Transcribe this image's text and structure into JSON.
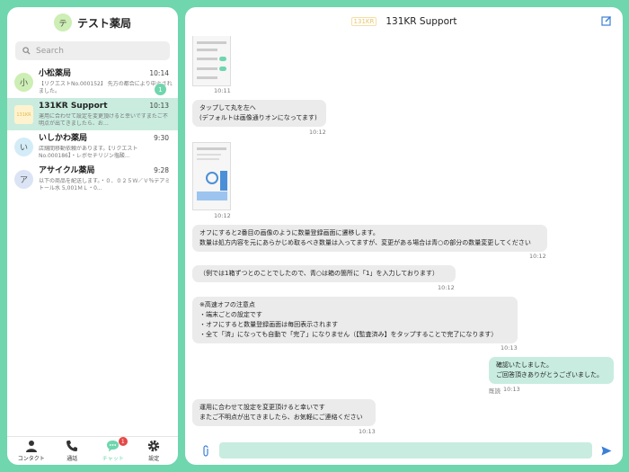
{
  "left": {
    "avatar": "テ",
    "title": "テスト薬局",
    "search_placeholder": "Search",
    "chats": [
      {
        "avatar": "小",
        "avatar_color": "#cdeeb4",
        "name": "小松薬局",
        "preview": "【リクエストNo.000152】 先方の都合により中止されました。",
        "time": "10:14",
        "badge": "1"
      },
      {
        "avatar": "131KR",
        "avatar_color": "#fff3cf",
        "name": "131KR Support",
        "preview": "運用に合わせて設定を変更頂けると幸いですまたご不明点が出てきましたら、お…",
        "time": "10:13",
        "badge": ""
      },
      {
        "avatar": "い",
        "avatar_color": "#d3ecf7",
        "name": "いしかわ薬局",
        "preview": "店舗間移動依頼があります。【リクエストNo.000186】・レボセチリジン塩酸...",
        "time": "9:30",
        "badge": ""
      },
      {
        "avatar": "ア",
        "avatar_color": "#dbe4f5",
        "name": "アサイクル薬局",
        "preview": "以下の商品を配送します。・０．０２５Ｗ／Ｖ％デアミトール水 5,001ＭＬ・0...",
        "time": "9:28",
        "badge": ""
      }
    ],
    "tabs": [
      {
        "label": "コンタクト",
        "icon": "person-icon"
      },
      {
        "label": "通話",
        "icon": "phone-icon"
      },
      {
        "label": "チャット",
        "icon": "chat-icon",
        "badge": "1"
      },
      {
        "label": "設定",
        "icon": "gear-icon"
      }
    ]
  },
  "right": {
    "logo": "131KR",
    "title": "131KR Support",
    "messages": [
      {
        "text": "",
        "time": "10:11"
      },
      {
        "text": "タップして丸を左へ\n(デフォルトは画像通りオンになってます)",
        "time": "10:12"
      },
      {
        "text": "",
        "time": "10:12"
      },
      {
        "text": "オフにすると2番目の画像のように数量登録画面に遷移します。\n数量は処方内容を元にあらかじめ取るべき数量は入ってますが、変更がある場合は青○の部分の数量変更してください",
        "time": "10:12"
      },
      {
        "text": "（例では1箱ずつとのことでしたので、青○は箱の箇所に「1」を入力しております）",
        "time": "10:12"
      },
      {
        "text": "※高速オフの注意点\n・端末ごとの設定です\n・オフにすると数量登録画面は毎回表示されます\n・全て「済」になっても自動で「完了」になりません（【監査済み】をタップすることで完了になります）",
        "time": "10:13"
      },
      {
        "text": "確認いたしました。\nご回答頂きありがとうございました。",
        "time": "10:13",
        "read": "既読"
      },
      {
        "text": "運用に合わせて設定を変更頂けると幸いです\nまたご不明点が出てきましたら、お気軽にご連絡ください",
        "time": "10:13"
      }
    ],
    "input_placeholder": "",
    "colors": {
      "accent": "#6fd6ae",
      "incoming": "#ebebeb",
      "outgoing": "#c8ece0"
    }
  }
}
